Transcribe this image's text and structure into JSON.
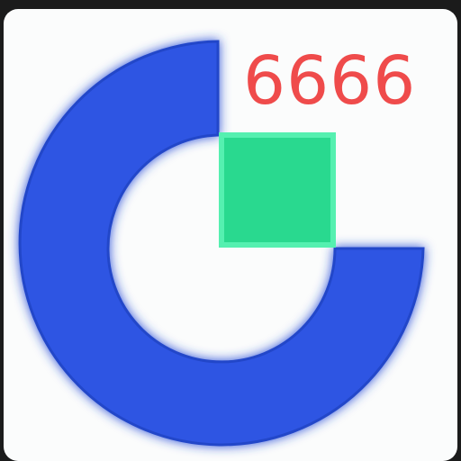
{
  "app_icon": {
    "icon": "ring-with-square-logo-icon",
    "badge_number": "6666",
    "colors": {
      "ring": "#2f55e3",
      "square": "#29d98f",
      "badge_text": "#ef4b4b",
      "tile_background": "#fbfcfc",
      "outer_background": "#1b1b1b"
    }
  }
}
